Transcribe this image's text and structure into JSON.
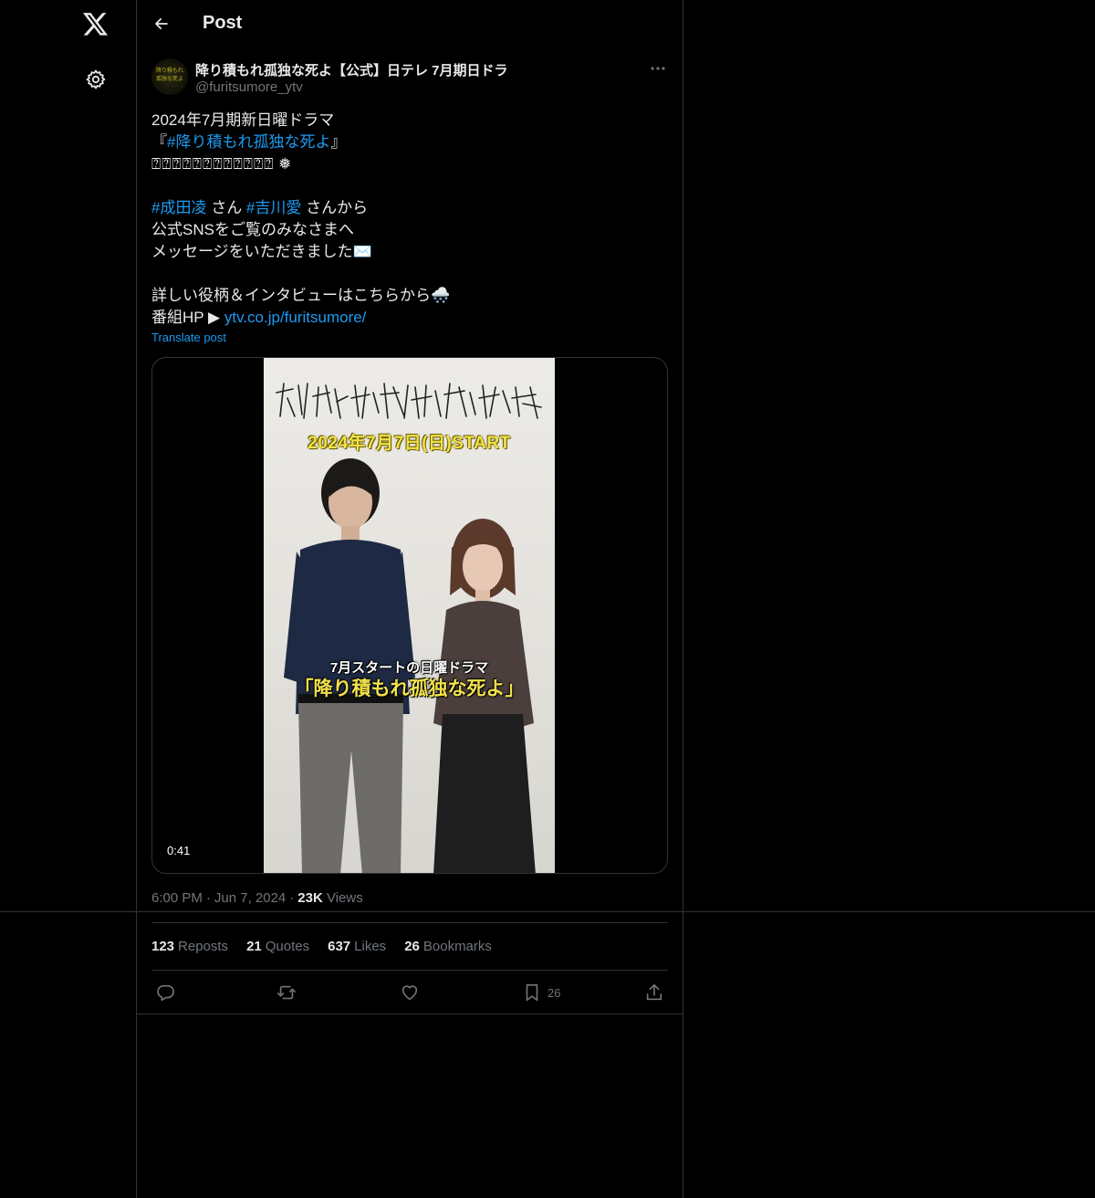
{
  "header": {
    "title": "Post"
  },
  "author": {
    "name": "降り積もれ孤独な死よ【公式】日テレ 7月期日ドラ",
    "handle": "@furitsumore_ytv",
    "avatar_text": "降り積もれ 孤独な死よ"
  },
  "tweet": {
    "l1": "2024年7月期新日曜ドラマ",
    "l2_open": "『",
    "l2_hashtag": "#降り積もれ孤独な死よ",
    "l2_close": "』",
    "l3_boxes": "⍰⍰⍰⍰⍰⍰⍰⍰⍰⍰⍰⍰",
    "l3_emoji": "❅",
    "l4_tag1": "#成田凌",
    "l4_mid": " さん ",
    "l4_tag2": "#吉川愛",
    "l4_end": " さんから",
    "l5": "公式SNSをご覧のみなさまへ",
    "l6": "メッセージをいただきました✉️",
    "l7": "詳しい役柄＆インタビューはこちらから🌨️",
    "l8_text": "番組HP ▶ ",
    "l8_link": "ytv.co.jp/furitsumore/",
    "translate": "Translate post"
  },
  "media": {
    "title_art": "降り積もれ孤独な死よ",
    "date": "2024年7月7日(日)START",
    "caption1": "7月スタートの日曜ドラマ",
    "caption2": "「降り積もれ孤独な死よ」",
    "duration": "0:41"
  },
  "meta": {
    "time": "6:00 PM",
    "date": "Jun 7, 2024",
    "views_num": "23K",
    "views_label": "Views"
  },
  "stats": {
    "reposts_num": "123",
    "reposts_label": "Reposts",
    "quotes_num": "21",
    "quotes_label": "Quotes",
    "likes_num": "637",
    "likes_label": "Likes",
    "bookmarks_num": "26",
    "bookmarks_label": "Bookmarks"
  },
  "actions": {
    "bookmark_count": "26"
  },
  "colors": {
    "background": "#000000",
    "text": "#e7e9ea",
    "muted": "#71767b",
    "link": "#1d9bf0",
    "border": "#2f3336"
  },
  "icons": [
    "x-logo-icon",
    "gear-icon",
    "back-arrow-icon",
    "more-icon",
    "reply-icon",
    "repost-icon",
    "like-icon",
    "bookmark-icon",
    "share-icon"
  ]
}
